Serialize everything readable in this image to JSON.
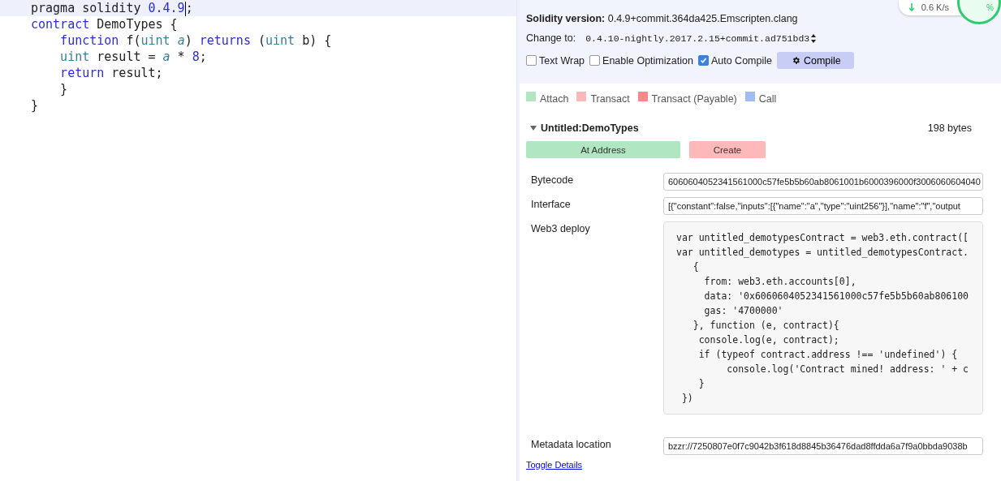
{
  "editor": {
    "lines": [
      {
        "current": true,
        "tokens": [
          {
            "text": "pragma solidity ",
            "kind": "plain"
          },
          {
            "text": "0.4.9",
            "kind": "number",
            "cursor": true
          },
          {
            "text": ";",
            "kind": "plain"
          }
        ]
      },
      {
        "current": false,
        "tokens": [
          {
            "text": "contract",
            "kind": "keyword"
          },
          {
            "text": " DemoTypes {",
            "kind": "plain"
          }
        ]
      },
      {
        "current": false,
        "tokens": [
          {
            "text": "    function",
            "kind": "keyword"
          },
          {
            "text": " f(",
            "kind": "plain"
          },
          {
            "text": "uint ",
            "kind": "type"
          },
          {
            "text": "a",
            "kind": "param"
          },
          {
            "text": ") ",
            "kind": "plain"
          },
          {
            "text": "returns",
            "kind": "keyword"
          },
          {
            "text": " (",
            "kind": "plain"
          },
          {
            "text": "uint",
            "kind": "type"
          },
          {
            "text": " b) {",
            "kind": "plain"
          }
        ]
      },
      {
        "current": false,
        "tokens": [
          {
            "text": "    uint",
            "kind": "type"
          },
          {
            "text": " result = ",
            "kind": "plain"
          },
          {
            "text": "a",
            "kind": "param"
          },
          {
            "text": " * ",
            "kind": "plain"
          },
          {
            "text": "8",
            "kind": "number"
          },
          {
            "text": ";",
            "kind": "plain"
          }
        ]
      },
      {
        "current": false,
        "tokens": [
          {
            "text": "    return",
            "kind": "keyword"
          },
          {
            "text": " result;",
            "kind": "plain"
          }
        ]
      },
      {
        "current": false,
        "tokens": [
          {
            "text": "    }",
            "kind": "plain"
          }
        ]
      },
      {
        "current": false,
        "tokens": [
          {
            "text": "}",
            "kind": "plain"
          }
        ]
      }
    ]
  },
  "network_widget": {
    "speed": "0.6 K/s",
    "percent": "%"
  },
  "compiler": {
    "version_label": "Solidity version:",
    "version": "0.4.9+commit.364da425.Emscripten.clang",
    "change_label": "Change to:",
    "change_value": "0.4.10-nightly.2017.2.15+commit.ad751bd3",
    "options": [
      {
        "label": "Text Wrap",
        "checked": false
      },
      {
        "label": "Enable Optimization",
        "checked": false
      },
      {
        "label": "Auto Compile",
        "checked": true
      }
    ],
    "compile_button": "Compile"
  },
  "legend": [
    {
      "label": "Attach",
      "color": "#b1e6c3"
    },
    {
      "label": "Transact",
      "color": "#fdb9b9"
    },
    {
      "label": "Transact (Payable)",
      "color": "#f58a8a"
    },
    {
      "label": "Call",
      "color": "#9fbdf0"
    }
  ],
  "contract": {
    "name": "Untitled:DemoTypes",
    "expanded": true,
    "size": "198 bytes",
    "buttons": [
      {
        "label": "At Address",
        "kind": "attach"
      },
      {
        "label": "Create",
        "kind": "transact"
      }
    ],
    "details": [
      {
        "kind": "field",
        "label": "Bytecode",
        "value": "6060604052341561000c57fe5b5b60ab8061001b6000396000f3006060604040"
      },
      {
        "kind": "field",
        "label": "Interface",
        "value": "[{\"constant\":false,\"inputs\":[{\"name\":\"a\",\"type\":\"uint256\"}],\"name\":\"f\",\"output"
      },
      {
        "kind": "code",
        "label": "Web3 deploy",
        "lines": [
          "var untitled_demotypesContract = web3.eth.contract([",
          "var untitled_demotypes = untitled_demotypesContract.",
          "   {",
          "     from: web3.eth.accounts[0],",
          "     data: '0x6060604052341561000c57fe5b5b60ab806100",
          "     gas: '4700000'",
          "   }, function (e, contract){",
          "    console.log(e, contract);",
          "    if (typeof contract.address !== 'undefined') {",
          "         console.log('Contract mined! address: ' + c",
          "    }",
          " })"
        ]
      },
      {
        "kind": "field",
        "label": "Metadata location",
        "value": "bzzr://7250807e0f7c9042b3f618d8845b36476dad8ffdda6a7f9a0bbda9038b"
      }
    ]
  },
  "toggle_link": "Toggle Details"
}
